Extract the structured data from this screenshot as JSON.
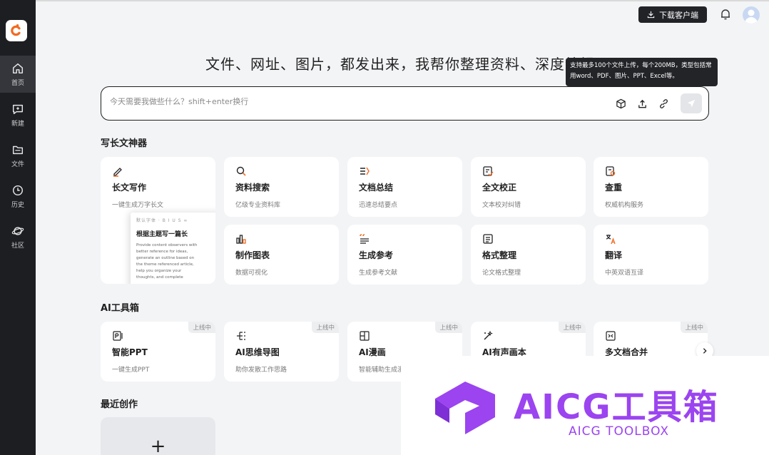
{
  "sidebar": {
    "items": [
      {
        "label": "首页",
        "icon": "home-icon"
      },
      {
        "label": "新建",
        "icon": "new-chat-icon"
      },
      {
        "label": "文件",
        "icon": "folder-icon"
      },
      {
        "label": "历史",
        "icon": "clock-icon"
      },
      {
        "label": "社区",
        "icon": "planet-icon"
      }
    ]
  },
  "topbar": {
    "download_label": "下载客户端"
  },
  "headline": "文件、网址、图片，都发出来，我帮你整理资料、深度编辑",
  "tooltip": "支持最多100个文件上传，每个200MB，类型包括常用word、PDF、图片、PPT、Excel等。",
  "search": {
    "placeholder": "今天需要我做些什么？shift+enter换行"
  },
  "writing": {
    "title": "写长文神器",
    "featured": {
      "title": "长文写作",
      "desc": "一键生成万字长文",
      "preview_toolbar": "默认字体 · B I U S ∞",
      "preview_title": "根据主题写一篇长",
      "preview_body": "Provide content observers with better reference for ideas, generate an outline based on the theme referenced article, help you organize your thoughts, and complete"
    },
    "cards": [
      {
        "title": "资料搜索",
        "desc": "亿级专业资料库"
      },
      {
        "title": "文档总结",
        "desc": "迅速总结要点"
      },
      {
        "title": "全文校正",
        "desc": "文本校对纠错"
      },
      {
        "title": "查重",
        "desc": "权威机构服务"
      },
      {
        "title": "制作图表",
        "desc": "数据可视化"
      },
      {
        "title": "生成参考",
        "desc": "生成参考文献"
      },
      {
        "title": "格式整理",
        "desc": "论文格式整理"
      },
      {
        "title": "翻译",
        "desc": "中英双语互译"
      }
    ]
  },
  "toolbox": {
    "title": "AI工具箱",
    "badge": "上线中",
    "cards": [
      {
        "title": "智能PPT",
        "desc": "一键生成PPT"
      },
      {
        "title": "AI思维导图",
        "desc": "助你发散工作思路"
      },
      {
        "title": "AI漫画",
        "desc": "智能辅助生成漫"
      },
      {
        "title": "AI有声画本",
        "desc": ""
      },
      {
        "title": "多文档合并",
        "desc": ""
      }
    ]
  },
  "recent": {
    "title": "最近创作",
    "new_label": "+"
  },
  "watermark": {
    "title": "AICG工具箱",
    "subtitle": "AICG TOOLBOX"
  },
  "colors": {
    "accent": "#f26a21",
    "sidebar_bg": "#1d1e22",
    "watermark": "#9b44f0"
  }
}
